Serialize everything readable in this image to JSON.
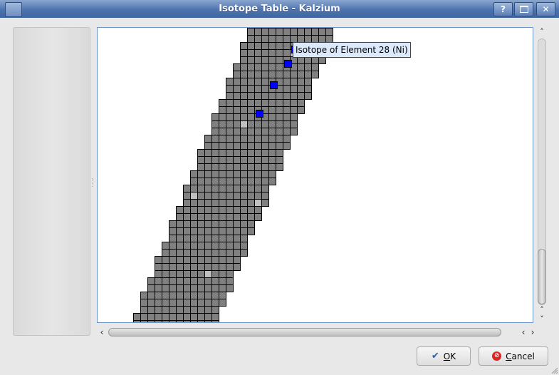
{
  "window": {
    "title": "Isotope Table - Kalzium",
    "help_button": "?",
    "maximize_icon": "maximize-icon",
    "close_button": "✕"
  },
  "isotope_view": {
    "tooltip": "Isotope of Element 28 (Ni)",
    "colors": {
      "cell_fill": "#808080",
      "cell_border": "#000000",
      "stable_cell_fill": "#c0c0c0",
      "highlight_fill": "#0000ff",
      "background": "#ffffff"
    }
  },
  "buttons": {
    "ok_label": "OK",
    "cancel_label": "Cancel",
    "ok_icon": "checkmark-icon",
    "cancel_icon": "cancel-icon"
  },
  "scrollbars": {
    "left_arrow": "‹",
    "right_arrow": "›",
    "right_arrow2": "›",
    "up_arrow": "˄",
    "down_arrow": "˅",
    "down_arrow2": "˅"
  }
}
